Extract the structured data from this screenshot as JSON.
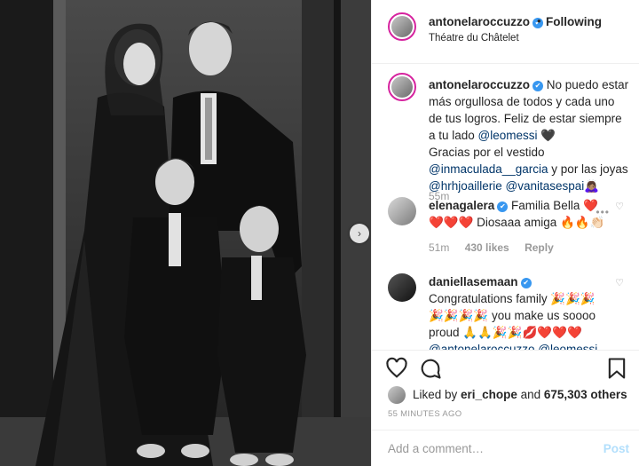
{
  "header": {
    "username": "antonelaroccuzzo",
    "separator": "•",
    "follow_label": "Following",
    "location": "Théatre du Châtelet"
  },
  "caption": {
    "username": "antonelaroccuzzo",
    "text_1": " No puedo estar más orgullosa de todos y cada uno de tus logros. Feliz de estar siempre a tu lado ",
    "mention_1": "@leomessi",
    "text_2": " 🖤",
    "text_3": "Gracias por el vestido",
    "mention_2": "@inmaculada__garcia",
    "text_4": " y por las joyas",
    "mention_3": "@hrhjoaillerie",
    "mention_4": "@vanitasespai",
    "text_5": "🙇🏽‍♀️",
    "time": "55m"
  },
  "comments": [
    {
      "username": "elenagalera",
      "text": " Familia Bella ❤️",
      "text_line2": "❤️❤️❤️ Diosaaa amiga 🔥🔥👏🏻",
      "time": "51m",
      "likes": "430 likes",
      "reply": "Reply",
      "more": "•••"
    },
    {
      "username": "daniellasemaan",
      "text": " Congratulations family 🎉🎉🎉",
      "text_line2": "🎉🎉🎉🎉 you make us soooo",
      "text_line3": "proud 🙏🙏🎉🎉💋❤️❤️❤️",
      "mention_1": "@antonelaroccuzzo",
      "mention_2": "@leomessi"
    }
  ],
  "actions": {
    "liked_by_prefix": "Liked by ",
    "liked_by_user": "eri_chope",
    "liked_by_mid": " and ",
    "liked_by_count": "675,303 others",
    "timestamp": "55 MINUTES AGO"
  },
  "add_comment": {
    "placeholder": "Add a comment…",
    "post_label": "Post"
  },
  "icons": {
    "verified": "verified-badge-icon",
    "heart": "heart-icon",
    "comment": "comment-icon",
    "share": "share-icon",
    "save": "bookmark-icon",
    "carousel": "chevron-right-icon"
  },
  "colors": {
    "verified": "#3897f0",
    "link": "#003569",
    "muted": "#999999",
    "post_disabled": "#b2dffc"
  }
}
